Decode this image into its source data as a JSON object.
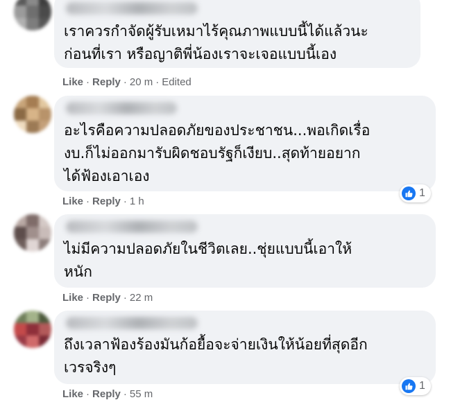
{
  "comments": [
    {
      "avatar_colors": [
        "#5a5a5a",
        "#8a8a8a",
        "#3e3e3e",
        "#9b9b9b",
        "#6f6f6f",
        "#4a4a4a",
        "#b0b0b0",
        "#7d7d7d",
        "#565656"
      ],
      "text": "เราควรกำจัดผู้รับเหมาไร้คุณภาพแบบนี้ได้แล้วนะ\nก่อนที่เรา หรือญาติพี่น้องเราจะเจอแบบนี้เอง",
      "like": "Like",
      "reply": "Reply",
      "time": "20 m",
      "edited": "Edited"
    },
    {
      "avatar_colors": [
        "#c8a57a",
        "#a57d52",
        "#e2c8a0",
        "#8b6a45",
        "#d7b488",
        "#b8936a",
        "#efdcc0",
        "#9c7a55",
        "#c4a07a"
      ],
      "text": "อะไรคือความปลอดภัยของประชาชน...พอเกิดเรื่อ\nงบ.ก็ไม่ออกมารับผิดชอบรัฐก็เงียบ..สุดท้ายอยาก\nได้ฟ้องเอาเอง",
      "like": "Like",
      "reply": "Reply",
      "time": "1 h",
      "reaction_count": "1"
    },
    {
      "avatar_colors": [
        "#b9a9a4",
        "#7f6c69",
        "#d4c9c6",
        "#5d4d4b",
        "#a08f8c",
        "#c9bcb9",
        "#6e5e5b",
        "#e0d6d4",
        "#8e7f7c"
      ],
      "text": "ไม่มีความปลอดภัยในชีวิตเลย..ชุ่ยแบบนี้เอาให้\nหนัก",
      "like": "Like",
      "reply": "Reply",
      "time": "22 m"
    },
    {
      "avatar_colors": [
        "#6f7f5a",
        "#a3b38a",
        "#4c5a3c",
        "#c44a4a",
        "#8e2f3a",
        "#b35a5a",
        "#9a3a45",
        "#d06a6a",
        "#7a2a35"
      ],
      "text": "ถึงเวลาฟ้องร้องมันก้อยื้อจะจ่ายเงินให้น้อยที่สุดอีก\nเวรจริงๆ",
      "like": "Like",
      "reply": "Reply",
      "time": "55 m",
      "reaction_count": "1"
    }
  ]
}
